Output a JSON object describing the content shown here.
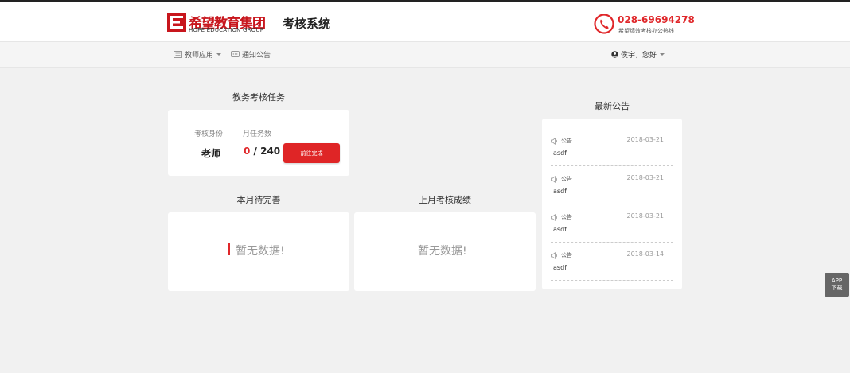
{
  "header": {
    "logo_cn": "希望教育集团",
    "logo_en": "HOPE EDUCATION GROUP",
    "system_title": "考核系统",
    "phone": "028-69694278",
    "phone_caption": "希望绩效考核办公热线",
    "brand_color": "#e0272a"
  },
  "nav": {
    "items": [
      {
        "label": "教师应用",
        "icon": "apps-icon",
        "has_dropdown": true
      },
      {
        "label": "通知公告",
        "icon": "message-icon",
        "has_dropdown": false
      }
    ],
    "user_greeting": "侯宇，您好"
  },
  "tasks": {
    "title": "教务考核任务",
    "identity_label": "考核身份",
    "identity_value": "老师",
    "monthly_label": "月任务数",
    "done": "0",
    "separator": " / ",
    "total": "240",
    "go_button": "前往完成"
  },
  "pending": {
    "title": "本月待完善",
    "empty_text": "暂无数据!"
  },
  "last_month": {
    "title": "上月考核成绩",
    "empty_text": "暂无数据!"
  },
  "announcements": {
    "title": "最新公告",
    "items": [
      {
        "tag": "公告",
        "date": "2018-03-21",
        "content": "asdf"
      },
      {
        "tag": "公告",
        "date": "2018-03-21",
        "content": "asdf"
      },
      {
        "tag": "公告",
        "date": "2018-03-21",
        "content": "asdf"
      },
      {
        "tag": "公告",
        "date": "2018-03-14",
        "content": "asdf"
      }
    ]
  },
  "app_download": {
    "line1": "APP",
    "line2": "下载"
  }
}
